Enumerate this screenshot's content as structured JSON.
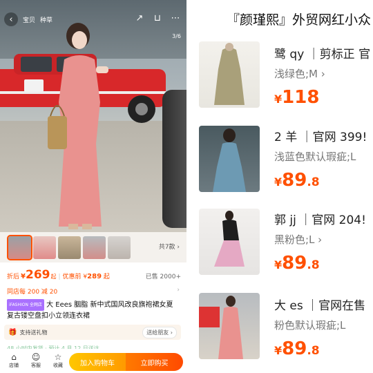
{
  "left": {
    "topbar": {
      "back_icon": "back-arrow-icon",
      "tab_baby": "宝贝",
      "tab_seed": "种草",
      "image_counter": "3/6"
    },
    "thumbs_more": "共7款 ›",
    "price": {
      "label": "折后",
      "currency": "¥",
      "value": "269",
      "suffix": "起",
      "before_label": "优惠前",
      "before_currency": "¥",
      "before_value": "289",
      "before_suffix": "起",
      "sold": "已售 2000+"
    },
    "coupon": "同店每 200 减 20",
    "title": {
      "badge": "iFASHION 全网店",
      "text": "大 Eees 胭脂 新中式国风改良旗袍裙女夏复古镂空盘扣小立领连衣裙"
    },
    "gift": {
      "text": "支持送礼物",
      "button": "送给朋友 ›"
    },
    "shipping": "48 小时内发货 · 预计 4 月 12 日送达",
    "bottombar": {
      "shop": "店铺",
      "service": "客服",
      "favorite": "收藏",
      "add_cart": "加入购物车",
      "buy_now": "立即购买"
    }
  },
  "right": {
    "shop_title": "『颜瑾熙』外贸网红小众",
    "items": [
      {
        "name": "鹭 qy ｜剪标正 官",
        "spec": "浅绿色;M ›",
        "currency": "¥",
        "price_int": "118",
        "price_dec": ""
      },
      {
        "name": "2 羊 ｜官网 399!",
        "spec": "浅蓝色默认瑕疵;L",
        "currency": "¥",
        "price_int": "89",
        "price_dec": ".8"
      },
      {
        "name": "郭 jj ｜官网 204!",
        "spec": "黑粉色;L ›",
        "currency": "¥",
        "price_int": "89",
        "price_dec": ".8"
      },
      {
        "name": "大 es ｜官网在售",
        "spec": "粉色默认瑕疵;L",
        "currency": "¥",
        "price_int": "89",
        "price_dec": ".8"
      }
    ]
  },
  "colors": {
    "accent": "#ff5000",
    "cart_button": "#ffb000",
    "buy_button": "#ff5a00"
  }
}
